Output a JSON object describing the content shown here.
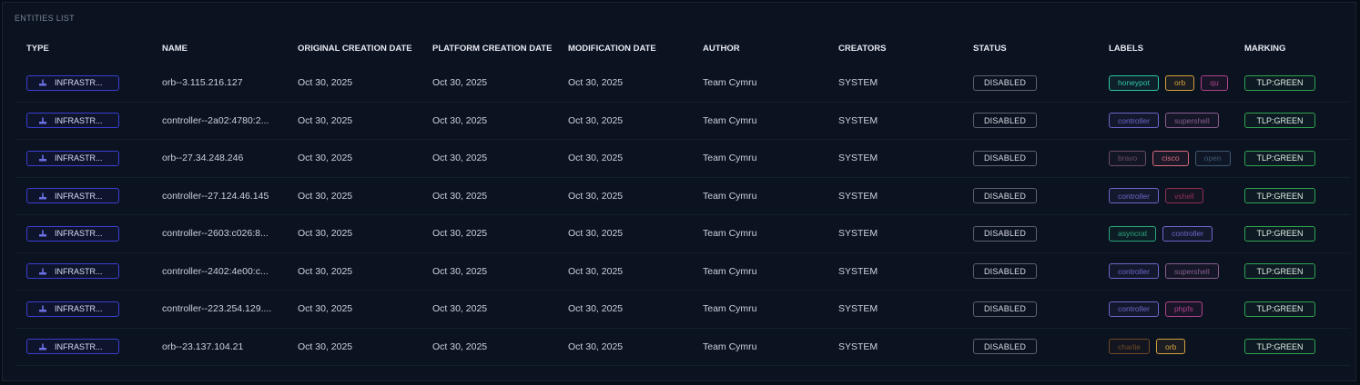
{
  "panel": {
    "title": "ENTITIES LIST"
  },
  "columns": {
    "type": "TYPE",
    "name": "NAME",
    "original_creation_date": "ORIGINAL CREATION DATE",
    "platform_creation_date": "PLATFORM CREATION DATE",
    "modification_date": "MODIFICATION DATE",
    "author": "AUTHOR",
    "creators": "CREATORS",
    "status": "STATUS",
    "labels": "LABELS",
    "marking": "MARKING"
  },
  "colors": {
    "type_chip": "#3b3fd0",
    "marking": "#2ea44f",
    "status": "#5a6272"
  },
  "rows": [
    {
      "type": "INFRASTR...",
      "type_icon": "infrastructure-icon",
      "name": "orb--3.115.216.127",
      "original_creation_date": "Oct 30, 2025",
      "platform_creation_date": "Oct 30, 2025",
      "modification_date": "Oct 30, 2025",
      "author": "Team Cymru",
      "creators": "SYSTEM",
      "status": "DISABLED",
      "labels": [
        {
          "text": "honeypot",
          "color": "#2fc6a8"
        },
        {
          "text": "orb",
          "color": "#d3a23a"
        },
        {
          "text": "qu",
          "color": "#b0428a"
        }
      ],
      "marking": "TLP:GREEN"
    },
    {
      "type": "INFRASTR...",
      "type_icon": "infrastructure-icon",
      "name": "controller--2a02:4780:2...",
      "original_creation_date": "Oct 30, 2025",
      "platform_creation_date": "Oct 30, 2025",
      "modification_date": "Oct 30, 2025",
      "author": "Team Cymru",
      "creators": "SYSTEM",
      "status": "DISABLED",
      "labels": [
        {
          "text": "controller",
          "color": "#6f66c9"
        },
        {
          "text": "supershell",
          "color": "#8a5e8f"
        }
      ],
      "marking": "TLP:GREEN"
    },
    {
      "type": "INFRASTR...",
      "type_icon": "infrastructure-icon",
      "name": "orb--27.34.248.246",
      "original_creation_date": "Oct 30, 2025",
      "platform_creation_date": "Oct 30, 2025",
      "modification_date": "Oct 30, 2025",
      "author": "Team Cymru",
      "creators": "SYSTEM",
      "status": "DISABLED",
      "labels": [
        {
          "text": "bravo",
          "color": "#6b4e63"
        },
        {
          "text": "cisco",
          "color": "#d66a7c"
        },
        {
          "text": "open",
          "color": "#3f5870"
        }
      ],
      "marking": "TLP:GREEN"
    },
    {
      "type": "INFRASTR...",
      "type_icon": "infrastructure-icon",
      "name": "controller--27.124.46.145",
      "original_creation_date": "Oct 30, 2025",
      "platform_creation_date": "Oct 30, 2025",
      "modification_date": "Oct 30, 2025",
      "author": "Team Cymru",
      "creators": "SYSTEM",
      "status": "DISABLED",
      "labels": [
        {
          "text": "controller",
          "color": "#6f66c9"
        },
        {
          "text": "vshell",
          "color": "#8f2f52"
        }
      ],
      "marking": "TLP:GREEN"
    },
    {
      "type": "INFRASTR...",
      "type_icon": "infrastructure-icon",
      "name": "controller--2603:c026:8...",
      "original_creation_date": "Oct 30, 2025",
      "platform_creation_date": "Oct 30, 2025",
      "modification_date": "Oct 30, 2025",
      "author": "Team Cymru",
      "creators": "SYSTEM",
      "status": "DISABLED",
      "labels": [
        {
          "text": "asyncrat",
          "color": "#2aa879"
        },
        {
          "text": "controller",
          "color": "#6f66c9"
        }
      ],
      "marking": "TLP:GREEN"
    },
    {
      "type": "INFRASTR...",
      "type_icon": "infrastructure-icon",
      "name": "controller--2402:4e00:c...",
      "original_creation_date": "Oct 30, 2025",
      "platform_creation_date": "Oct 30, 2025",
      "modification_date": "Oct 30, 2025",
      "author": "Team Cymru",
      "creators": "SYSTEM",
      "status": "DISABLED",
      "labels": [
        {
          "text": "controller",
          "color": "#6f66c9"
        },
        {
          "text": "supershell",
          "color": "#8a5e8f"
        }
      ],
      "marking": "TLP:GREEN"
    },
    {
      "type": "INFRASTR...",
      "type_icon": "infrastructure-icon",
      "name": "controller--223.254.129....",
      "original_creation_date": "Oct 30, 2025",
      "platform_creation_date": "Oct 30, 2025",
      "modification_date": "Oct 30, 2025",
      "author": "Team Cymru",
      "creators": "SYSTEM",
      "status": "DISABLED",
      "labels": [
        {
          "text": "controller",
          "color": "#6f66c9"
        },
        {
          "text": "phpfs",
          "color": "#b0428a"
        }
      ],
      "marking": "TLP:GREEN"
    },
    {
      "type": "INFRASTR...",
      "type_icon": "infrastructure-icon",
      "name": "orb--23.137.104.21",
      "original_creation_date": "Oct 30, 2025",
      "platform_creation_date": "Oct 30, 2025",
      "modification_date": "Oct 30, 2025",
      "author": "Team Cymru",
      "creators": "SYSTEM",
      "status": "DISABLED",
      "labels": [
        {
          "text": "charlie",
          "color": "#6e4a26"
        },
        {
          "text": "orb",
          "color": "#d3a23a"
        }
      ],
      "marking": "TLP:GREEN"
    }
  ]
}
